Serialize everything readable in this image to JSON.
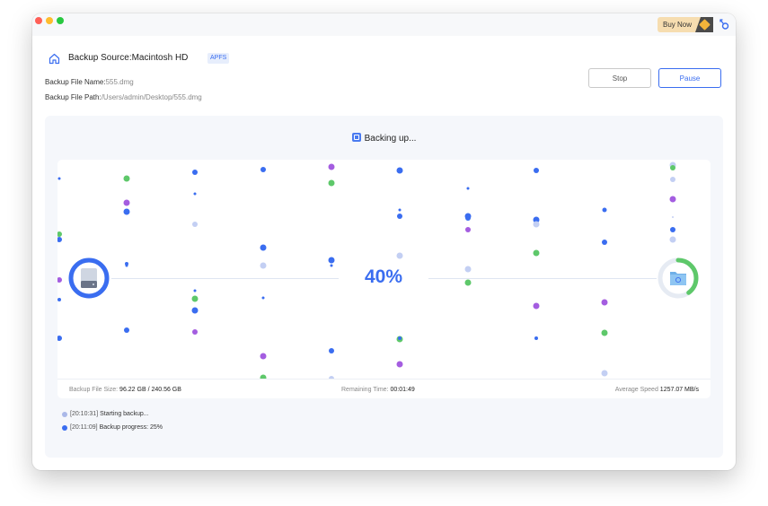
{
  "window": {
    "buy_now_label": "Buy Now"
  },
  "header": {
    "source_label": "Backup Source:Macintosh HD",
    "fs_badge": "APFS",
    "file_name_label": "Backup File Name:",
    "file_name_value": "555.dmg",
    "file_path_label": "Backup File Path:",
    "file_path_value": "/Users/admin/Desktop/555.dmg"
  },
  "buttons": {
    "stop": "Stop",
    "pause": "Pause"
  },
  "progress": {
    "status_text": "Backing up...",
    "percent_text": "40%",
    "percent_value": 40,
    "target_ring_percent": 40
  },
  "stats": {
    "file_size_label": "Backup File Size:",
    "file_size_value": "96.22 GB / 240.56 GB",
    "remaining_label": "Remaining Time:",
    "remaining_value": "00:01:49",
    "speed_label": "Average Speed",
    "speed_value": "1257.07 MB/s"
  },
  "log": [
    {
      "time": "[20:10:31]",
      "message": "Starting backup...",
      "dot_color": "#aab8e8"
    },
    {
      "time": "[20:11:09]",
      "message": "Backup progress: 25%",
      "dot_color": "#3a6df0"
    }
  ],
  "colors": {
    "accent": "#3a6df0",
    "green": "#5ec86a",
    "purple": "#a45de0",
    "light_blue": "#c3cff3"
  },
  "icons": {
    "home": "home-icon",
    "key": "key-icon",
    "status": "backup-status-icon",
    "source_drive": "hard-drive-icon",
    "target_folder": "folder-icon"
  }
}
